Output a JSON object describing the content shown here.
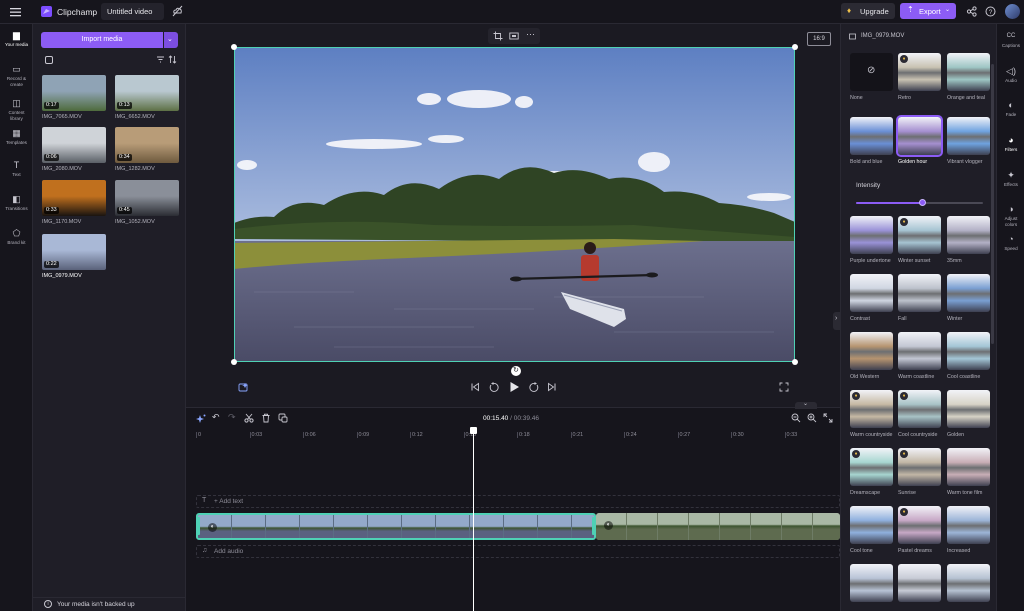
{
  "app": {
    "name": "Clipchamp",
    "project_title": "Untitled video"
  },
  "topbar": {
    "upgrade_label": "Upgrade",
    "export_label": "Export"
  },
  "left_nav": [
    {
      "label": "Your media",
      "icon": "folder-icon",
      "active": true
    },
    {
      "label": "Record &\ncreate",
      "icon": "camera-icon"
    },
    {
      "label": "Content\nlibrary",
      "icon": "library-icon"
    },
    {
      "label": "Templates",
      "icon": "templates-icon"
    },
    {
      "label": "Text",
      "icon": "text-icon"
    },
    {
      "label": "Transitions",
      "icon": "transitions-icon"
    },
    {
      "label": "Brand kit",
      "icon": "brand-kit-icon"
    }
  ],
  "media": {
    "import_label": "Import media",
    "items": [
      {
        "name": "IMG_7065.MOV",
        "duration": "0:17",
        "colors": [
          "#8fa3b5",
          "#4e6b3c"
        ]
      },
      {
        "name": "IMG_6652.MOV",
        "duration": "0:13",
        "colors": [
          "#b9c8d0",
          "#5d7044"
        ]
      },
      {
        "name": "IMG_2080.MOV",
        "duration": "0:06",
        "colors": [
          "#cfd3d8",
          "#5a5f66"
        ]
      },
      {
        "name": "IMG_1282.MOV",
        "duration": "0:34",
        "colors": [
          "#b89c78",
          "#6e5a3e"
        ]
      },
      {
        "name": "IMG_1170.MOV",
        "duration": "0:33",
        "colors": [
          "#c0701e",
          "#1a1410"
        ]
      },
      {
        "name": "IMG_1052.MOV",
        "duration": "0:45",
        "colors": [
          "#8a8f99",
          "#2b2d33"
        ]
      },
      {
        "name": "IMG_0979.MOV",
        "duration": "0:22",
        "colors": [
          "#a9b8d6",
          "#5a627a"
        ]
      }
    ],
    "backup_notice": "Your media isn't backed up"
  },
  "preview": {
    "aspect_ratio": "16:9"
  },
  "timeline": {
    "current_time": "00:15.40",
    "total_time": "00:39.46",
    "ticks": [
      "0",
      "0:03",
      "0:06",
      "0:09",
      "0:12",
      "0:15",
      "0:18",
      "0:21",
      "0:24",
      "0:27",
      "0:30",
      "0:33"
    ],
    "add_text_label": "+ Add text",
    "add_audio_label": "Add audio"
  },
  "filters_panel": {
    "clip_name": "IMG_0979.MOV",
    "intensity_label": "Intensity",
    "intensity": 0.52,
    "top_filters": [
      {
        "name": "None",
        "tone": "none"
      },
      {
        "name": "Retro",
        "tone": "#c8c2b2",
        "premium": true
      },
      {
        "name": "Orange and teal",
        "tone": "#9ec6c4"
      },
      {
        "name": "Bold and blue",
        "tone": "#6a8fd6"
      },
      {
        "name": "Golden hour",
        "tone": "#a58fd0",
        "selected": true
      },
      {
        "name": "Vibrant vlogger",
        "tone": "#6fa3e0"
      }
    ],
    "filters": [
      {
        "name": "Purple undertone",
        "tone": "#9a92d8"
      },
      {
        "name": "Winter sunset",
        "tone": "#a6c4d2",
        "premium": true
      },
      {
        "name": "35mm",
        "tone": "#b3b1c6"
      },
      {
        "name": "Contrast",
        "tone": "#d0d6e2"
      },
      {
        "name": "Fall",
        "tone": "#bdc2cc"
      },
      {
        "name": "Winter",
        "tone": "#7a9fd2"
      },
      {
        "name": "Old Western",
        "tone": "#b69470"
      },
      {
        "name": "Warm coastline",
        "tone": "#c3c7d3"
      },
      {
        "name": "Cool coastline",
        "tone": "#a4c6d6"
      },
      {
        "name": "Warm countryside",
        "tone": "#c6b9a4",
        "premium": true
      },
      {
        "name": "Cool countryside",
        "tone": "#a8c3c6",
        "premium": true
      },
      {
        "name": "Golden",
        "tone": "#d7d3c6"
      },
      {
        "name": "Dreamscape",
        "tone": "#a7d6d0",
        "premium": true
      },
      {
        "name": "Sunrise",
        "tone": "#c2b7a6",
        "premium": true
      },
      {
        "name": "Warm tone film",
        "tone": "#c8aeb6"
      },
      {
        "name": "Cool tone",
        "tone": "#8fb0de"
      },
      {
        "name": "Pastel dreams",
        "tone": "#c7a8c6",
        "premium": true
      },
      {
        "name": "Increased",
        "tone": "#9db5d8"
      },
      {
        "name": "",
        "tone": "#b8c3d6"
      },
      {
        "name": "",
        "tone": "#c7cbd6"
      },
      {
        "name": "",
        "tone": "#b6c2d2"
      }
    ]
  },
  "right_nav": [
    {
      "label": "Captions",
      "icon": "captions-icon"
    },
    {
      "label": "Audio",
      "icon": "audio-icon"
    },
    {
      "label": "Fade",
      "icon": "fade-icon"
    },
    {
      "label": "Filters",
      "icon": "filters-icon",
      "active": true
    },
    {
      "label": "Effects",
      "icon": "effects-icon"
    },
    {
      "label": "Adjust\ncolors",
      "icon": "adjust-colors-icon"
    },
    {
      "label": "Speed",
      "icon": "speed-icon"
    }
  ],
  "colors": {
    "accent": "#8c5cf5",
    "clip_border": "#4fd1b5",
    "playhead": "#ffffff"
  }
}
